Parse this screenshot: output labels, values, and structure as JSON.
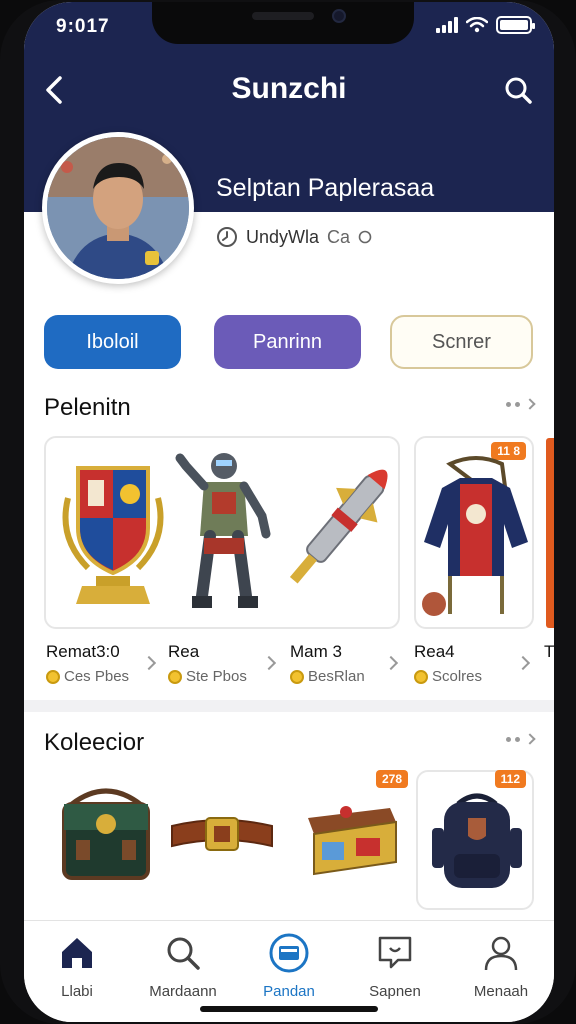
{
  "status": {
    "time": "9:017"
  },
  "header": {
    "title": "Sunzchi",
    "back_icon": "chevron-left-icon",
    "search_icon": "search-icon"
  },
  "profile": {
    "name": "Selptan Paplerasaa",
    "meta": "UndyWla",
    "meta_extra": "Ca",
    "meta_icon": "clock-icon"
  },
  "actions": {
    "primary_label": "Iboloil",
    "secondary_label": "Panrinn",
    "tertiary_label": "Scnrer"
  },
  "sections": {
    "featured": {
      "title": "Pelenitn",
      "badge": "11 8",
      "items": [
        {
          "label": "Remat3:0",
          "sub": "Ces Pbes"
        },
        {
          "label": "Rea",
          "sub": "Ste Pbos"
        },
        {
          "label": "Mam 3",
          "sub": "BesRlan"
        },
        {
          "label": "Rea4",
          "sub": "Scolres"
        }
      ],
      "edge_label": "T"
    },
    "collection": {
      "title": "Koleecior",
      "badges": [
        "278",
        "112"
      ]
    }
  },
  "tabbar": {
    "items": [
      {
        "label": "Llabi",
        "icon": "home-icon"
      },
      {
        "label": "Mardaann",
        "icon": "search-icon"
      },
      {
        "label": "Pandan",
        "icon": "wallet-icon"
      },
      {
        "label": "Sapnen",
        "icon": "chat-icon"
      },
      {
        "label": "Menaah",
        "icon": "profile-icon"
      }
    ],
    "active_index": 2
  },
  "colors": {
    "header_bg": "#1c2550",
    "primary": "#1f6bc2",
    "secondary": "#6b5bb8",
    "accent_badge": "#f07a20",
    "active_tab": "#1c75c4"
  }
}
